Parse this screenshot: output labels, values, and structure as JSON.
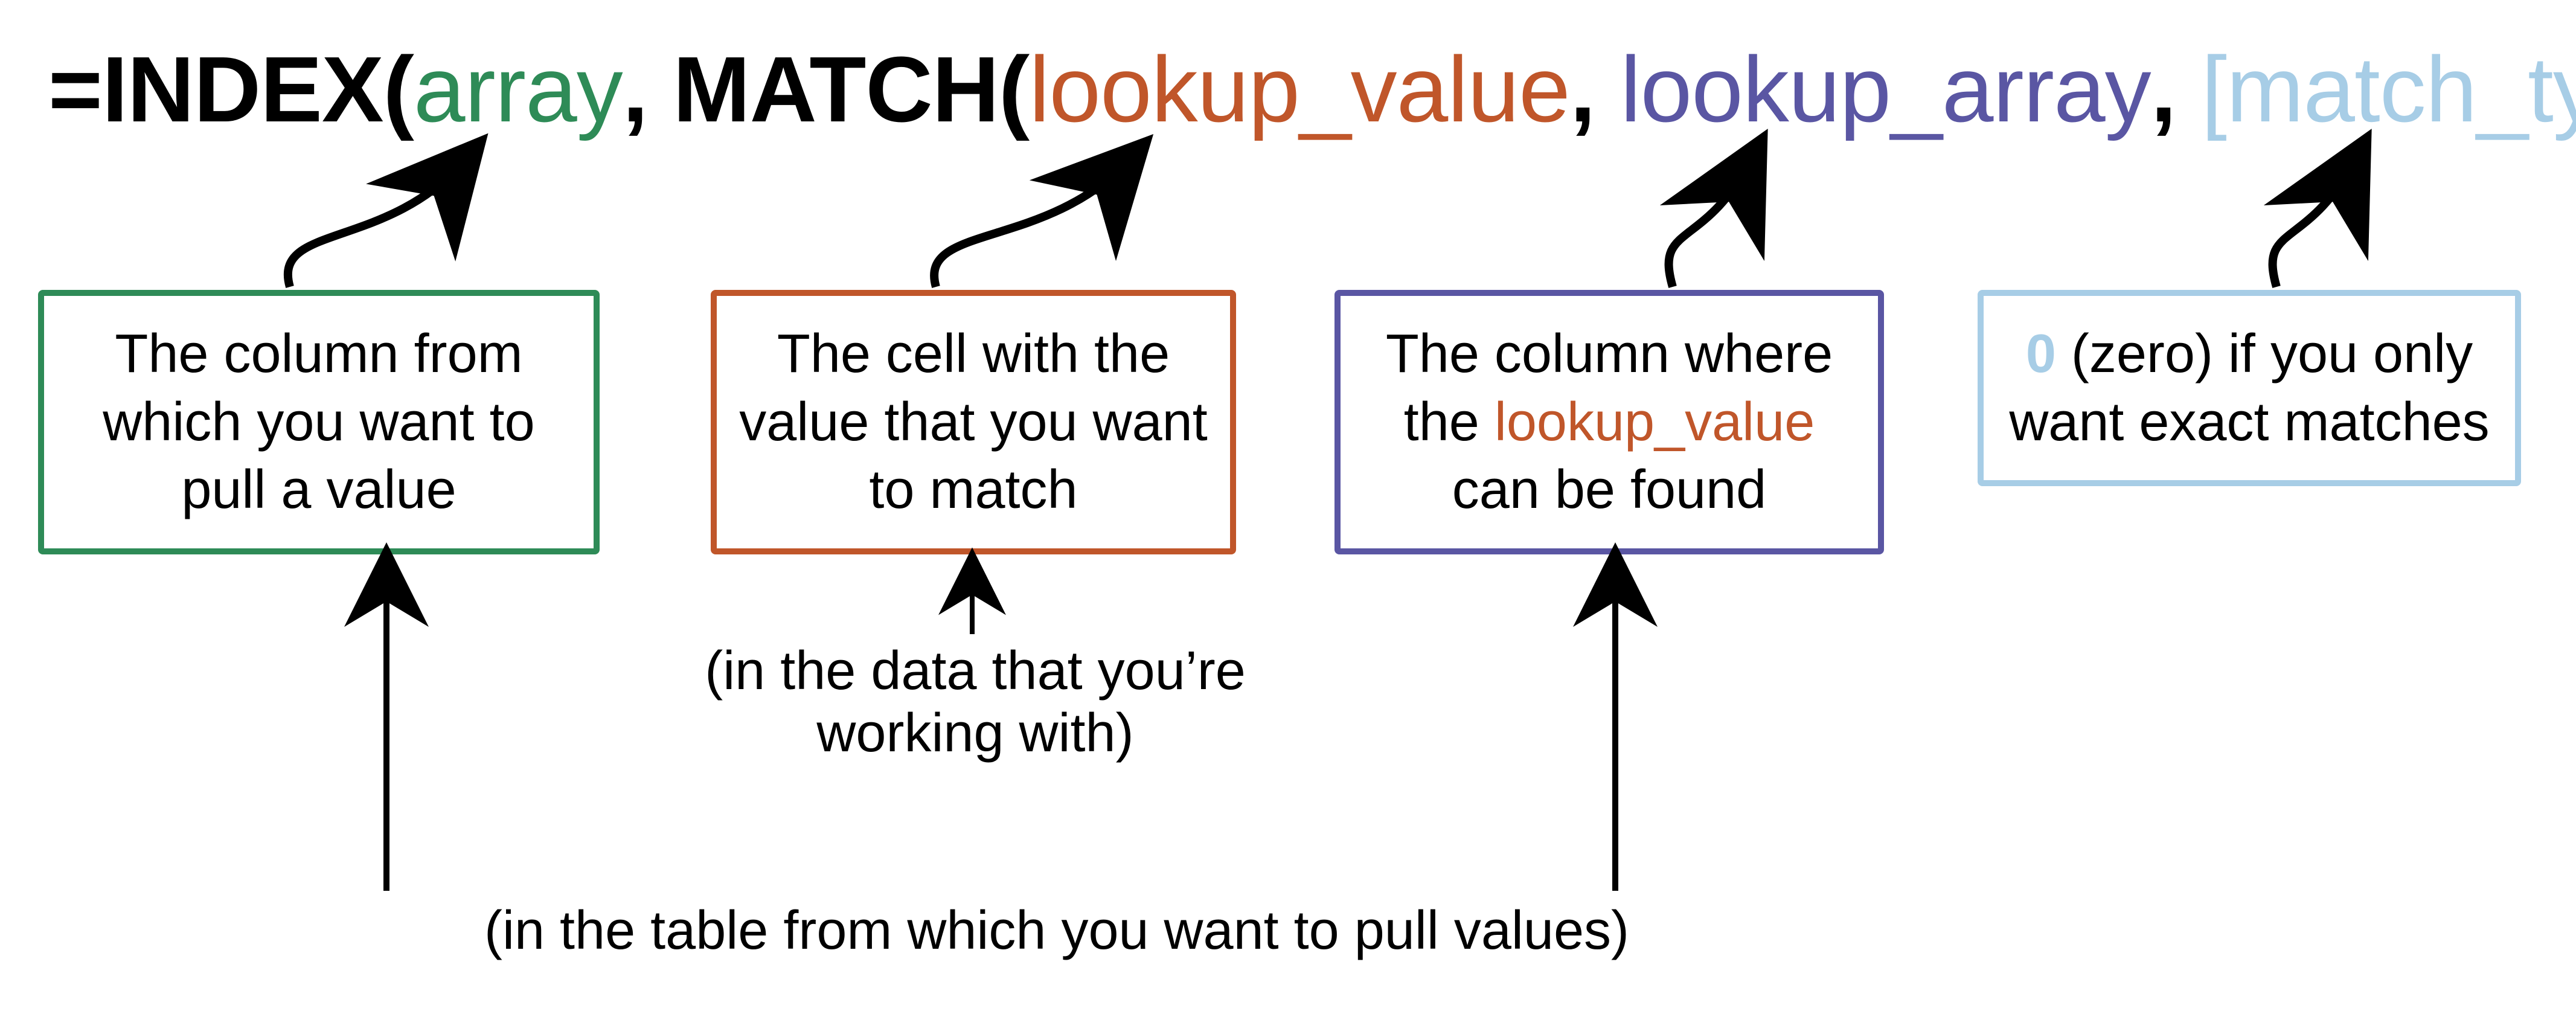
{
  "colors": {
    "black": "#000000",
    "green": "#2e8b57",
    "orange": "#c0562a",
    "purple": "#5a56a3",
    "lightblue": "#a7cde6"
  },
  "formula": {
    "t1": "=INDEX(",
    "t2_array": "array",
    "t3": ", MATCH(",
    "t4_lookup_value": "lookup_value",
    "t5": ", ",
    "t6_lookup_array": "lookup_array",
    "t7": ", ",
    "t8_match_type": "[match_type]",
    "t9": "))"
  },
  "callouts": {
    "array": "The column from which you want to pull a value",
    "lookup_value": "The cell with the value that you want to match",
    "lookup_array_pre": "The column where the ",
    "lookup_array_em": "lookup_value",
    "lookup_array_post": " can be found",
    "match_type_em": "0",
    "match_type_post": " (zero) if you only want exact matches"
  },
  "annotations": {
    "working_with": "(in the data that you’re working with)",
    "pull_values": "(in the table from which you want to pull values)"
  }
}
